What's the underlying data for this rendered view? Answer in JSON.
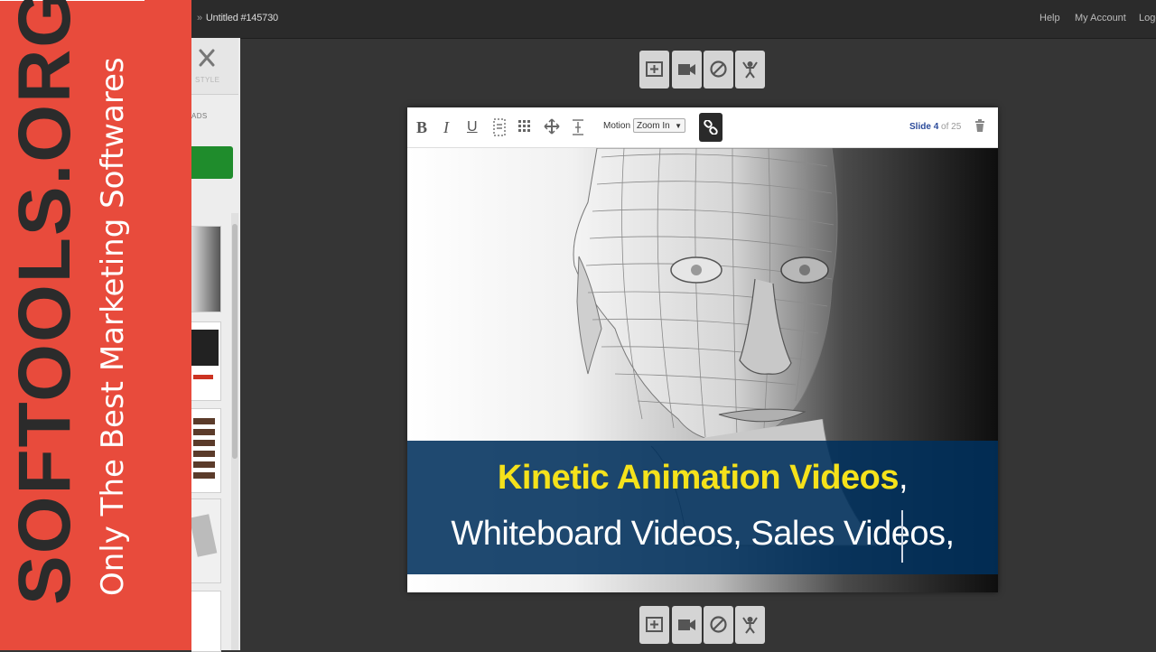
{
  "header": {
    "breadcrumb_sep": "»",
    "project_title": "Untitled #145730",
    "links": [
      "Help",
      "My Account",
      "Logo"
    ]
  },
  "left_panel": {
    "style_tab_label": "STYLE",
    "section_label": "ADS"
  },
  "watermark": {
    "brand": "SOFTOOLS.ORG",
    "tagline": "Only The Best Marketing Softwares"
  },
  "editor": {
    "format_buttons": [
      "B",
      "I",
      "U"
    ],
    "motion_label": "Motion",
    "motion_value": "Zoom In",
    "slide_prefix": "Slide",
    "slide_current": "4",
    "slide_of": "of 25"
  },
  "slide": {
    "caption_line1": "Kinetic Animation Videos",
    "caption_line1_tail": ",",
    "caption_line2": "Whiteboard Videos, Sales Videos,"
  },
  "colors": {
    "banner": "#e84b3c",
    "caption_bg": "#00305c",
    "caption_highlight": "#f5e21b",
    "green_button": "#1f8c2c"
  },
  "icons": [
    "add-slide-icon",
    "video-icon",
    "ban-icon",
    "character-icon",
    "link-icon",
    "trash-icon",
    "close-x-icon"
  ]
}
